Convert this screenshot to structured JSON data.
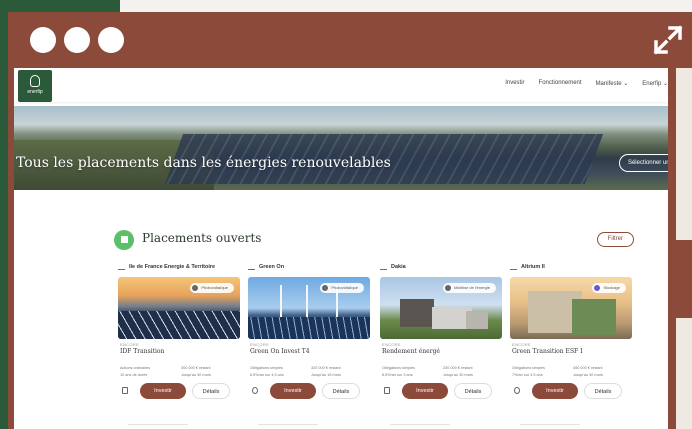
{
  "window": {
    "controls": [
      "dot",
      "dot",
      "dot"
    ],
    "expand_icon": "expand-arrows-icon"
  },
  "nav": {
    "logo_text": "enerfip",
    "links": [
      "Investir",
      "Fonctionnement",
      "Manifeste",
      "Enerfip"
    ]
  },
  "hero": {
    "title": "Tous les placements dans les énergies renouvelables",
    "button": "Sélectionner une"
  },
  "section": {
    "title": "Placements ouverts",
    "filter_label": "Filtrer"
  },
  "cards": [
    {
      "issuer": "Ile de France Energie & Territoire",
      "tag": "Photovoltaïque",
      "label": "ENCORE",
      "title": "IDF Transition",
      "specs": [
        "Actions ordinaires",
        "300 000 € restant",
        "10 ans de durée",
        "Jusqu'au 30 mars"
      ],
      "invest": "Investir",
      "details": "Détails"
    },
    {
      "issuer": "Green On",
      "tag": "Photovoltaïque",
      "label": "ENCORE",
      "title": "Green On Invest T4",
      "specs": [
        "Obligations simples",
        "320 000 € restant",
        "6,5%/an sur 4,5 ans",
        "Jusqu'au 15 mars"
      ],
      "invest": "Investir",
      "details": "Détails"
    },
    {
      "issuer": "Dakia",
      "tag": "Maîtrise de l'énergie",
      "label": "ENCORE",
      "title": "Rendement énergé",
      "specs": [
        "Obligations simples",
        "230 000 € restant",
        "8,5%/an sur 3 ans",
        "Jusqu'au 30 mars"
      ],
      "invest": "Investir",
      "details": "Détails"
    },
    {
      "issuer": "Altrium II",
      "tag": "Stockage",
      "label": "ENCORE",
      "title": "Green Transition ESF I",
      "specs": [
        "Obligations simples",
        "450 000 € restant",
        "7%/an sur 4,5 ans",
        "Jusqu'au 30 mars"
      ],
      "invest": "Investir",
      "details": "Détails"
    }
  ],
  "colors": {
    "brand_green": "#2b5a3a",
    "brand_brown": "#8b4a3a",
    "flag_green": "#5cbf6a"
  }
}
